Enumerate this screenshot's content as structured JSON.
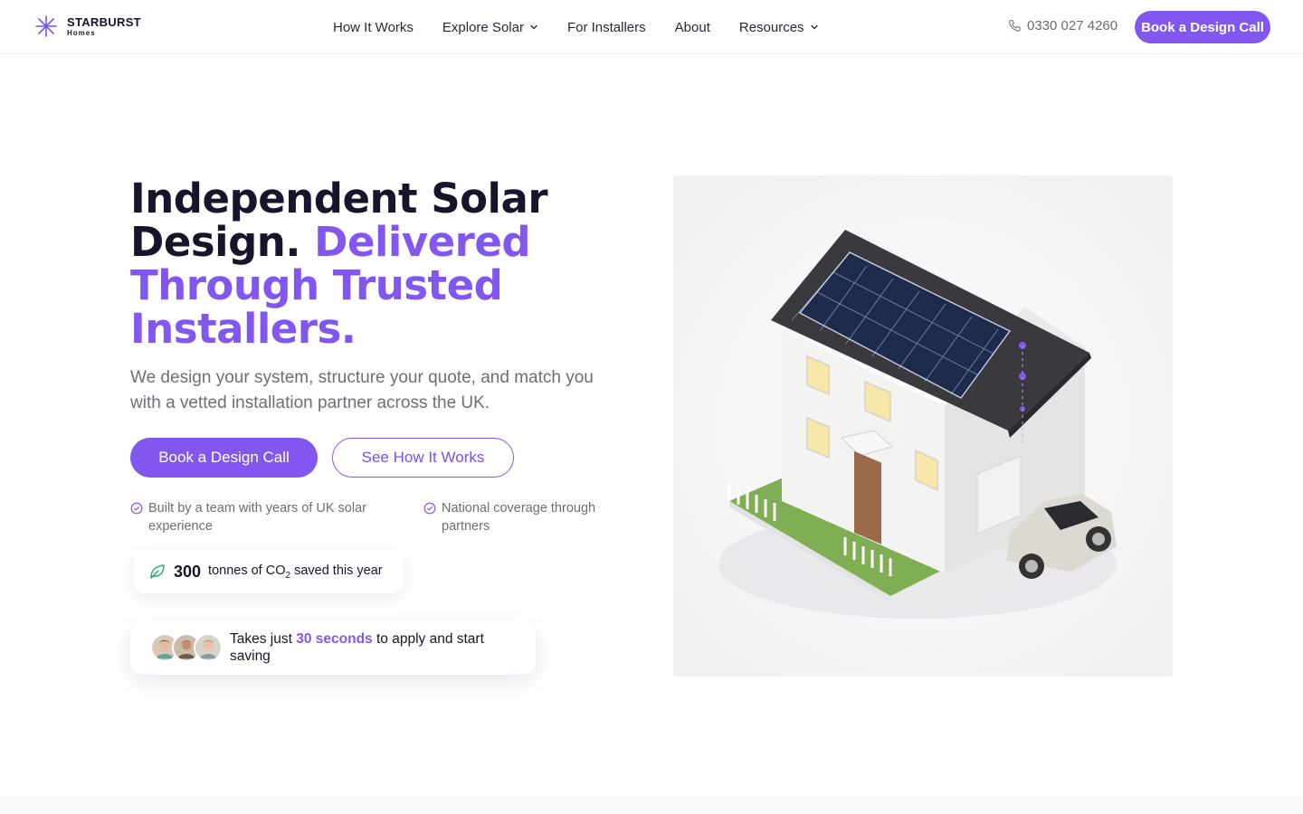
{
  "brand": {
    "name": "STARBURST",
    "sub": "Homes",
    "accent_color": "#8257f0"
  },
  "nav": {
    "links": [
      {
        "label": "How It Works",
        "has_dropdown": false
      },
      {
        "label": "Explore Solar",
        "has_dropdown": true
      },
      {
        "label": "For Installers",
        "has_dropdown": false
      },
      {
        "label": "About",
        "has_dropdown": false
      },
      {
        "label": "Resources",
        "has_dropdown": true
      }
    ],
    "phone": "0330 027 4260",
    "cta": "Book a Design Call"
  },
  "hero": {
    "headline_main": "Independent Solar Design.",
    "headline_accent": "Delivered Through Trusted Installers.",
    "subtext": "We design your system, structure your quote, and match you with a vetted installation partner across the UK.",
    "primary_button": "Book a Design Call",
    "secondary_button": "See How It Works",
    "features": [
      "Built by a team with years of UK solar experience",
      "National coverage through partners"
    ],
    "co2": {
      "number": "300",
      "text_before_sub": "tonnes of CO",
      "subscript": "2",
      "text_after_sub": " saved this year"
    },
    "apply": {
      "before": "Takes just ",
      "highlight": "30 seconds",
      "after": " to apply and start saving"
    }
  }
}
